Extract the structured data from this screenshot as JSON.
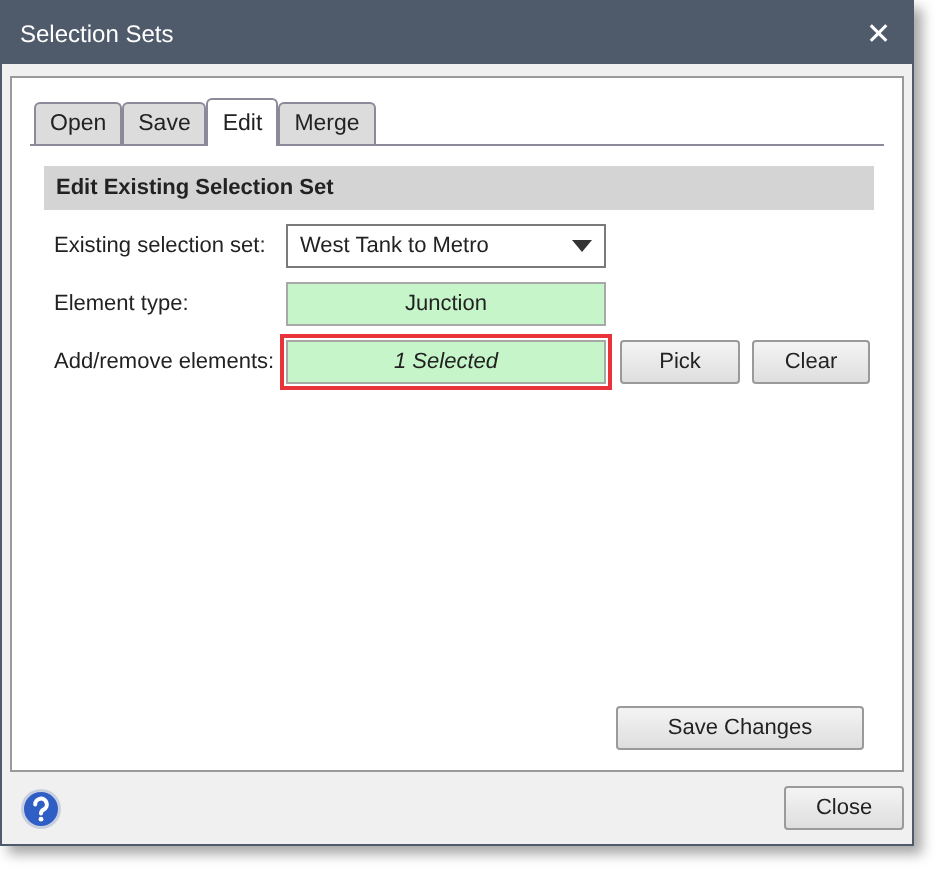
{
  "window": {
    "title": "Selection Sets",
    "close": "✕"
  },
  "tabs": [
    {
      "label": "Open",
      "selected": false
    },
    {
      "label": "Save",
      "selected": false
    },
    {
      "label": "Edit",
      "selected": true
    },
    {
      "label": "Merge",
      "selected": false
    }
  ],
  "section": {
    "title": "Edit Existing Selection Set"
  },
  "fields": [
    {
      "kind": "dropdown",
      "label": "Existing selection set:",
      "value": "West Tank to Metro",
      "highlighted": false
    },
    {
      "kind": "readonly",
      "label": "Element type:",
      "value": "Junction",
      "highlighted": false
    },
    {
      "kind": "selection",
      "label": "Add/remove elements:",
      "value": "1 Selected",
      "highlighted": true,
      "buttons": [
        "Pick",
        "Clear"
      ]
    }
  ],
  "save_button": "Save Changes",
  "footer": {
    "close_button": "Close"
  }
}
